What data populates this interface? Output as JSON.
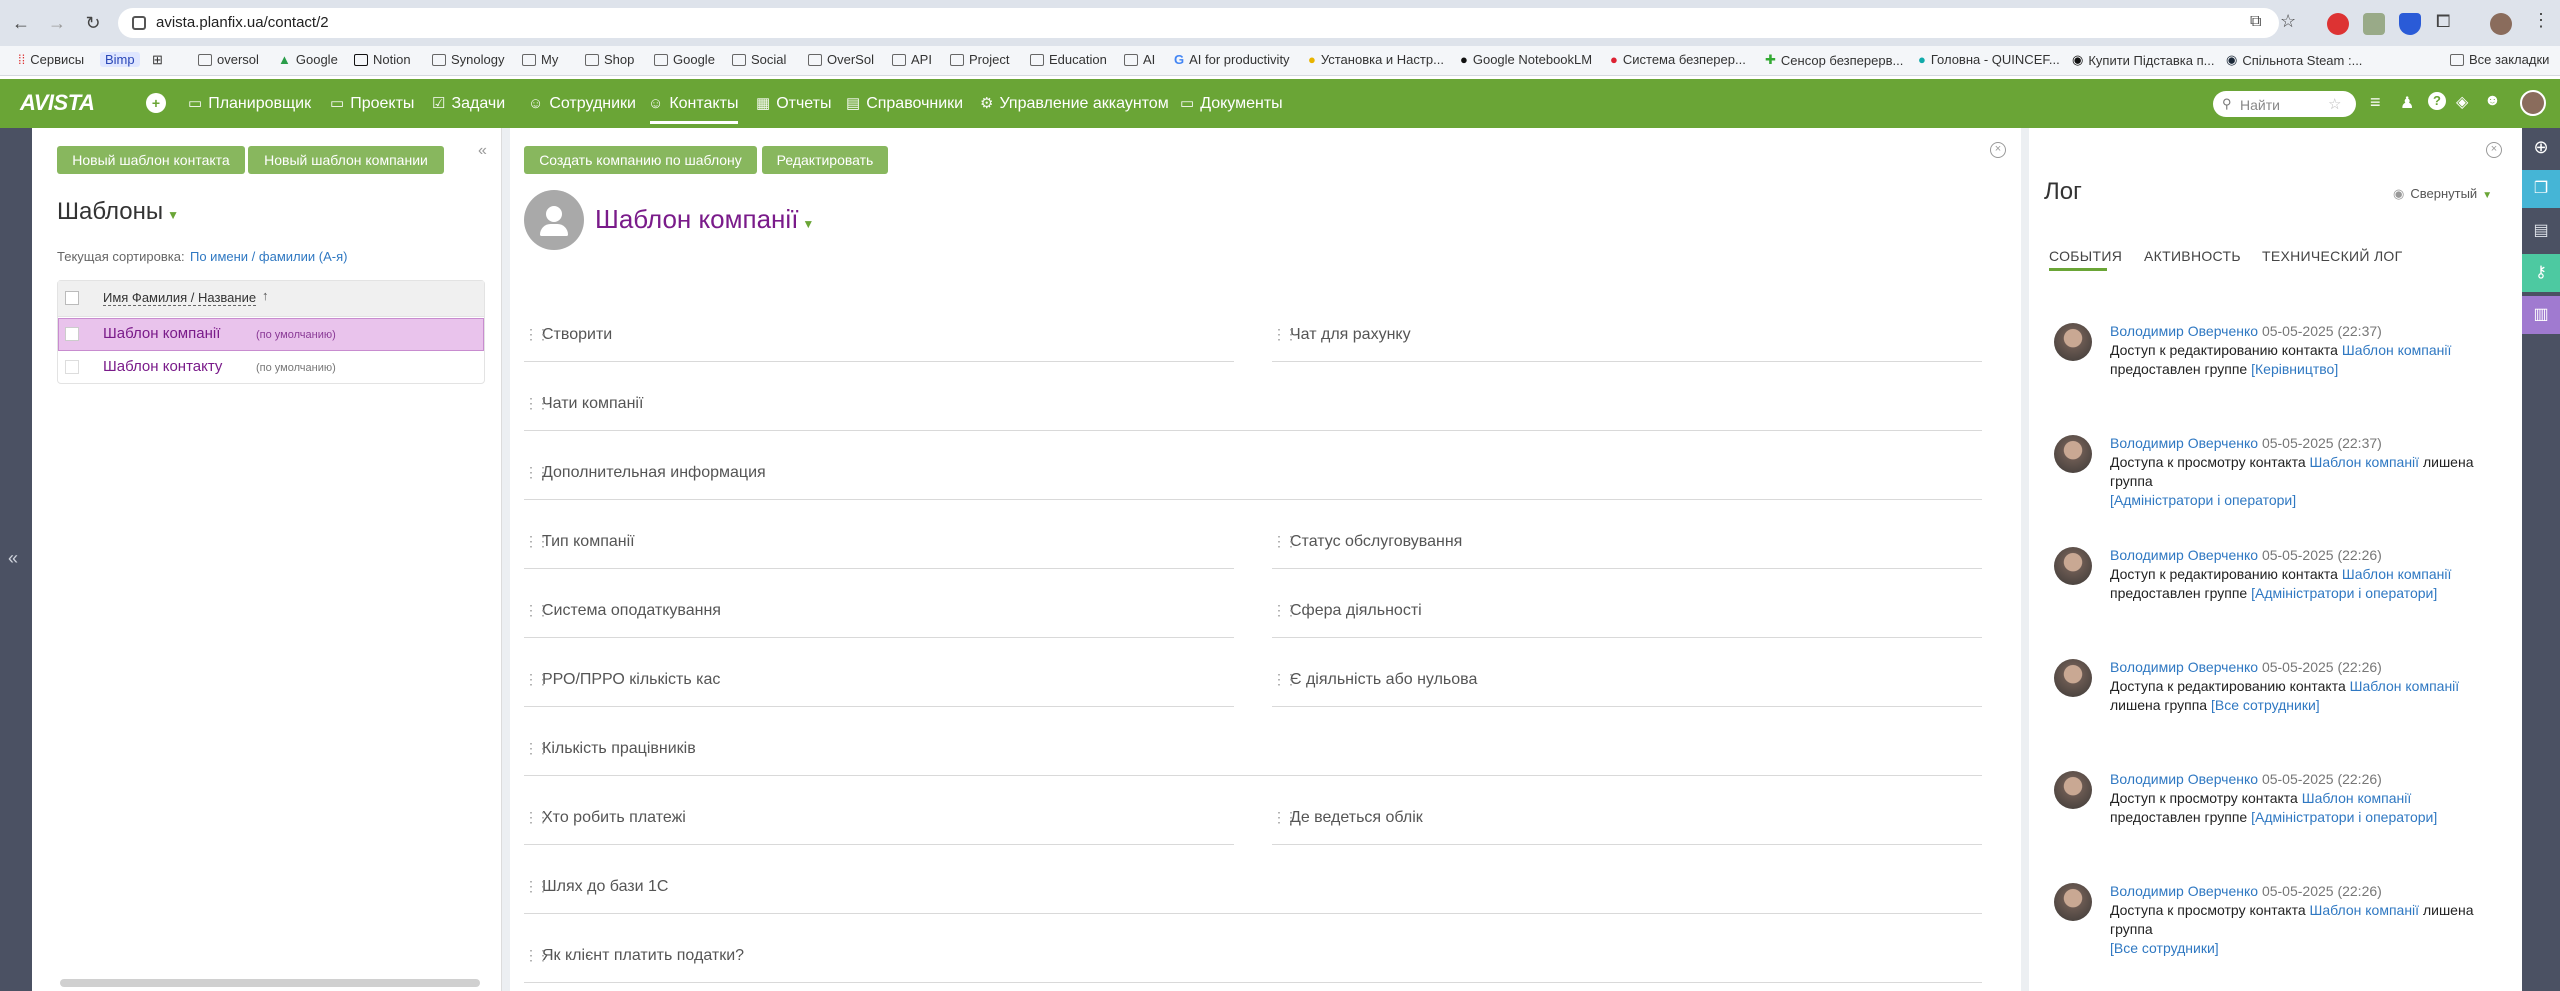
{
  "browser": {
    "url": "avista.planfix.ua/contact/2",
    "bookmarks": [
      "Сервисы",
      "Bimp",
      "",
      "oversol",
      "Google",
      "Notion",
      "Synology",
      "My",
      "Shop",
      "Google",
      "Social",
      "OverSol",
      "API",
      "Project",
      "Education",
      "AI",
      "AI for productivity",
      "Установка и Настр...",
      "Google NotebookLM",
      "Система безперер...",
      "Сенсор безперерв...",
      "Головна - QUINCEF...",
      "Купити Підставка п...",
      "Спільнота Steam :..."
    ],
    "all_bookmarks": "Все закладки"
  },
  "app": {
    "logo": "AVISTA",
    "nav": [
      "Планировщик",
      "Проекты",
      "Задачи",
      "Сотрудники",
      "Контакты",
      "Отчеты",
      "Справочники",
      "Управление аккаунтом",
      "Документы"
    ],
    "search_placeholder": "Найти",
    "accent": "#6aa536"
  },
  "left": {
    "btn_contact_template": "Новый шаблон контакта",
    "btn_company_template": "Новый шаблон компании",
    "title": "Шаблоны",
    "sort_label": "Текущая сортировка:",
    "sort_value": "По имени / фамилии (А-я)",
    "col_header": "Имя Фамилия / Название",
    "rows": [
      {
        "name": "Шаблон компанії",
        "tag": "(по умолчанию)"
      },
      {
        "name": "Шаблон контакту",
        "tag": "(по умолчанию)"
      }
    ]
  },
  "center": {
    "btn_create": "Создать компанию по шаблону",
    "btn_edit": "Редактировать",
    "title": "Шаблон компанії",
    "fields": [
      "Створити",
      "Чат для рахунку",
      "Чати компанії",
      "Дополнительная информация",
      "Тип компанії",
      "Статус обслуговування",
      "Система оподаткування",
      "Сфера діяльності",
      "РРО/ПРРО кількість кас",
      "Є діяльність або нульова",
      "Кількість працівників",
      "Хто робить платежі",
      "Де ведеться облік",
      "Шлях до бази 1С",
      "Як клієнт платить податки?"
    ]
  },
  "log": {
    "title": "Лог",
    "collapsed": "Свернутый",
    "tabs": [
      "СОБЫТИЯ",
      "АКТИВНОСТЬ",
      "ТЕХНИЧЕСКИЙ ЛОГ"
    ],
    "entries": [
      {
        "author": "Володимир Оверченко",
        "date": "05-05-2025 (22:37)",
        "pre": "Доступ к редактированию контакта",
        "link": "Шаблон компанії",
        "mid": "предоставлен группе",
        "group": "[Керівництво]"
      },
      {
        "author": "Володимир Оверченко",
        "date": "05-05-2025 (22:37)",
        "pre": "Доступа к просмотру контакта",
        "link": "Шаблон компанії",
        "mid": "лишена группа",
        "group": "[Адміністратори і оператори]"
      },
      {
        "author": "Володимир Оверченко",
        "date": "05-05-2025 (22:26)",
        "pre": "Доступ к редактированию контакта",
        "link": "Шаблон компанії",
        "mid": "предоставлен группе",
        "group": "[Адміністратори і оператори]"
      },
      {
        "author": "Володимир Оверченко",
        "date": "05-05-2025 (22:26)",
        "pre": "Доступа к редактированию контакта",
        "link": "Шаблон компанії",
        "mid": "лишена группа",
        "group": "[Все сотрудники]"
      },
      {
        "author": "Володимир Оверченко",
        "date": "05-05-2025 (22:26)",
        "pre": "Доступ к просмотру контакта",
        "link": "Шаблон компанії",
        "mid": "предоставлен группе",
        "group": "[Адміністратори і оператори]"
      },
      {
        "author": "Володимир Оверченко",
        "date": "05-05-2025 (22:26)",
        "pre": "Доступа к просмотру контакта",
        "link": "Шаблон компанії",
        "mid": "лишена группа",
        "group": "[Все сотрудники]"
      }
    ]
  }
}
